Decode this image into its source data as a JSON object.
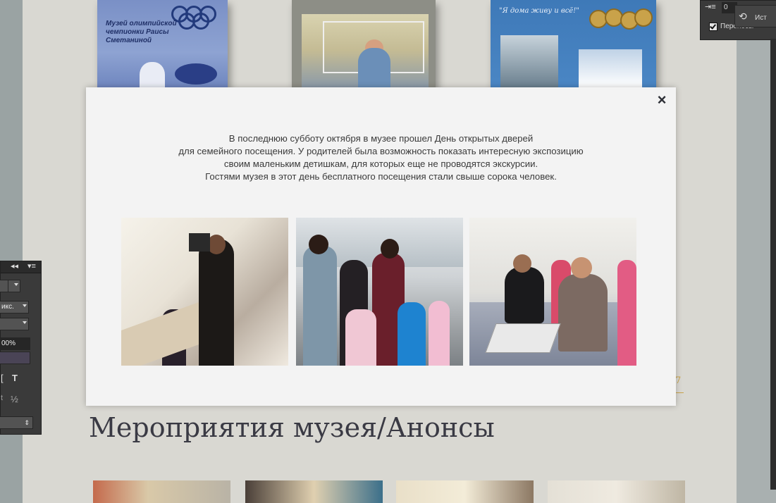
{
  "books": {
    "book1_text": "Музей олимпийской чемпионки Раисы Сметаниной",
    "book3_quote": "\"Я дома живу и всё!\""
  },
  "modal": {
    "close_label": "×",
    "text_lines": [
      "В последнюю субботу октября в музее прошел День открытых дверей",
      "для семейного посещения. У родителей была возможность показать интересную экспозицию",
      "своим маленьким детишкам, для которых еще не проводятся экскурсии.",
      "Гостями музея в этот день бесплатного посещения стали свыше сорока человек."
    ]
  },
  "page": {
    "section_title": "Мероприятия музея/Анонсы",
    "partial_number": "7"
  },
  "photoshop": {
    "left_zoom": "00%",
    "left_unit": "икс.",
    "left_fraction": "½",
    "left_t": "T",
    "left_letter": "t",
    "right_value": "0",
    "right_checkbox_label": "Переносы",
    "right_history_label": "Ист"
  },
  "colors": {
    "modal_bg": "#f3f3f3",
    "accent_gold": "#c9a34a",
    "title_text": "#3a3a44"
  }
}
